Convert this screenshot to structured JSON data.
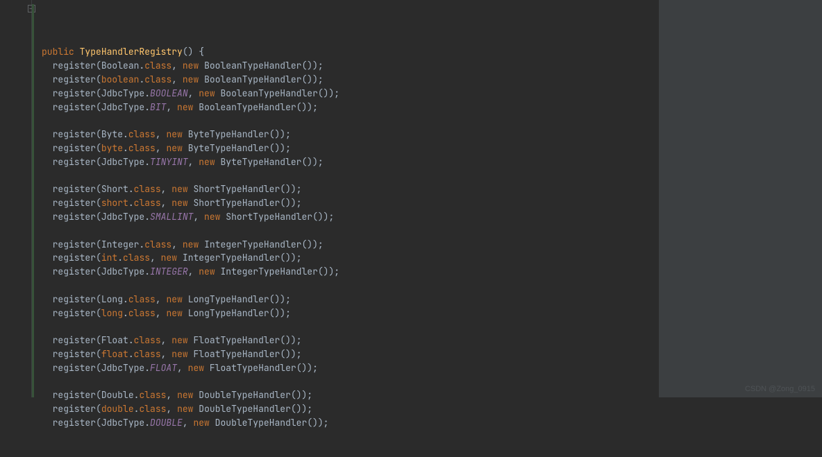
{
  "editor": {
    "lines": [
      {
        "indent": 0,
        "blank": false,
        "kind": "sig",
        "sig_kw": "public",
        "sig_name": "TypeHandlerRegistry",
        "sig_tail": "() {"
      },
      {
        "indent": 1,
        "blank": false,
        "kind": "reg",
        "arg_pre": "Boolean.",
        "arg_kw": "class",
        "handler": "BooleanTypeHandler"
      },
      {
        "indent": 1,
        "blank": false,
        "kind": "reg",
        "arg_pre_kw": "boolean",
        "arg_post": ".",
        "arg_kw": "class",
        "handler": "BooleanTypeHandler"
      },
      {
        "indent": 1,
        "blank": false,
        "kind": "reg",
        "arg_pre": "JdbcType.",
        "arg_it": "BOOLEAN",
        "handler": "BooleanTypeHandler"
      },
      {
        "indent": 1,
        "blank": false,
        "kind": "reg",
        "arg_pre": "JdbcType.",
        "arg_it": "BIT",
        "handler": "BooleanTypeHandler"
      },
      {
        "indent": 1,
        "blank": true
      },
      {
        "indent": 1,
        "blank": false,
        "kind": "reg",
        "arg_pre": "Byte.",
        "arg_kw": "class",
        "handler": "ByteTypeHandler"
      },
      {
        "indent": 1,
        "blank": false,
        "kind": "reg",
        "arg_pre_kw": "byte",
        "arg_post": ".",
        "arg_kw": "class",
        "handler": "ByteTypeHandler"
      },
      {
        "indent": 1,
        "blank": false,
        "kind": "reg",
        "arg_pre": "JdbcType.",
        "arg_it": "TINYINT",
        "handler": "ByteTypeHandler"
      },
      {
        "indent": 1,
        "blank": true
      },
      {
        "indent": 1,
        "blank": false,
        "kind": "reg",
        "arg_pre": "Short.",
        "arg_kw": "class",
        "handler": "ShortTypeHandler"
      },
      {
        "indent": 1,
        "blank": false,
        "kind": "reg",
        "arg_pre_kw": "short",
        "arg_post": ".",
        "arg_kw": "class",
        "handler": "ShortTypeHandler"
      },
      {
        "indent": 1,
        "blank": false,
        "kind": "reg",
        "arg_pre": "JdbcType.",
        "arg_it": "SMALLINT",
        "handler": "ShortTypeHandler"
      },
      {
        "indent": 1,
        "blank": true
      },
      {
        "indent": 1,
        "blank": false,
        "kind": "reg",
        "arg_pre": "Integer.",
        "arg_kw": "class",
        "handler": "IntegerTypeHandler"
      },
      {
        "indent": 1,
        "blank": false,
        "kind": "reg",
        "arg_pre_kw": "int",
        "arg_post": ".",
        "arg_kw": "class",
        "handler": "IntegerTypeHandler"
      },
      {
        "indent": 1,
        "blank": false,
        "kind": "reg",
        "arg_pre": "JdbcType.",
        "arg_it": "INTEGER",
        "handler": "IntegerTypeHandler"
      },
      {
        "indent": 1,
        "blank": true
      },
      {
        "indent": 1,
        "blank": false,
        "kind": "reg",
        "arg_pre": "Long.",
        "arg_kw": "class",
        "handler": "LongTypeHandler"
      },
      {
        "indent": 1,
        "blank": false,
        "kind": "reg",
        "arg_pre_kw": "long",
        "arg_post": ".",
        "arg_kw": "class",
        "handler": "LongTypeHandler"
      },
      {
        "indent": 1,
        "blank": true
      },
      {
        "indent": 1,
        "blank": false,
        "kind": "reg",
        "arg_pre": "Float.",
        "arg_kw": "class",
        "handler": "FloatTypeHandler"
      },
      {
        "indent": 1,
        "blank": false,
        "kind": "reg",
        "arg_pre_kw": "float",
        "arg_post": ".",
        "arg_kw": "class",
        "handler": "FloatTypeHandler"
      },
      {
        "indent": 1,
        "blank": false,
        "kind": "reg",
        "arg_pre": "JdbcType.",
        "arg_it": "FLOAT",
        "handler": "FloatTypeHandler"
      },
      {
        "indent": 1,
        "blank": true
      },
      {
        "indent": 1,
        "blank": false,
        "kind": "reg",
        "arg_pre": "Double.",
        "arg_kw": "class",
        "handler": "DoubleTypeHandler"
      },
      {
        "indent": 1,
        "blank": false,
        "kind": "reg",
        "arg_pre_kw": "double",
        "arg_post": ".",
        "arg_kw": "class",
        "handler": "DoubleTypeHandler"
      },
      {
        "indent": 1,
        "blank": false,
        "kind": "reg",
        "arg_pre": "JdbcType.",
        "arg_it": "DOUBLE",
        "handler": "DoubleTypeHandler"
      }
    ],
    "call_name": "register",
    "new_kw": "new",
    "comma": ", ",
    "tail": "());"
  },
  "watermark": "CSDN @Zong_0915"
}
